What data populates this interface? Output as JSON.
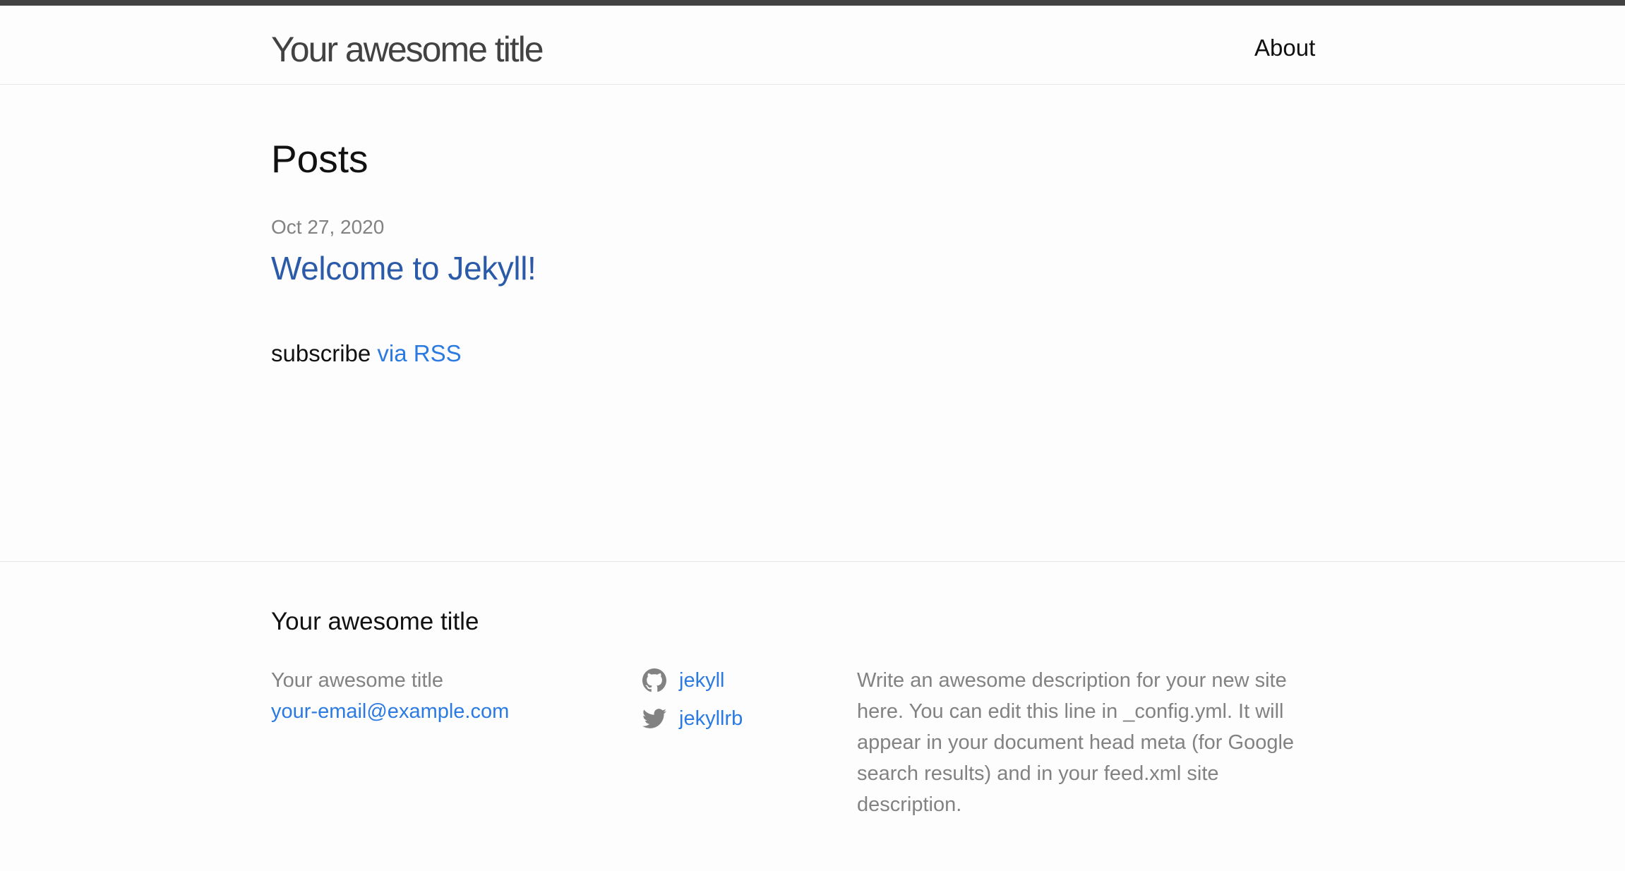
{
  "header": {
    "site_title": "Your awesome title",
    "nav": [
      {
        "label": "About"
      }
    ]
  },
  "main": {
    "heading": "Posts",
    "posts": [
      {
        "date": "Oct 27, 2020",
        "title": "Welcome to Jekyll!"
      }
    ],
    "subscribe_text": "subscribe",
    "rss_link_text": "via RSS"
  },
  "footer": {
    "heading": "Your awesome title",
    "author_name": "Your awesome title",
    "email": "your-email@example.com",
    "social": [
      {
        "icon": "github-icon",
        "label": "jekyll"
      },
      {
        "icon": "twitter-icon",
        "label": "jekyllrb"
      }
    ],
    "description": "Write an awesome description for your new site here. You can edit this line in _config.yml. It will appear in your document head meta (for Google search results) and in your feed.xml site description."
  },
  "colors": {
    "link": "#2a7ae2",
    "post_link": "#2a5aa8",
    "muted_text": "#828282",
    "header_border": "#424242"
  }
}
